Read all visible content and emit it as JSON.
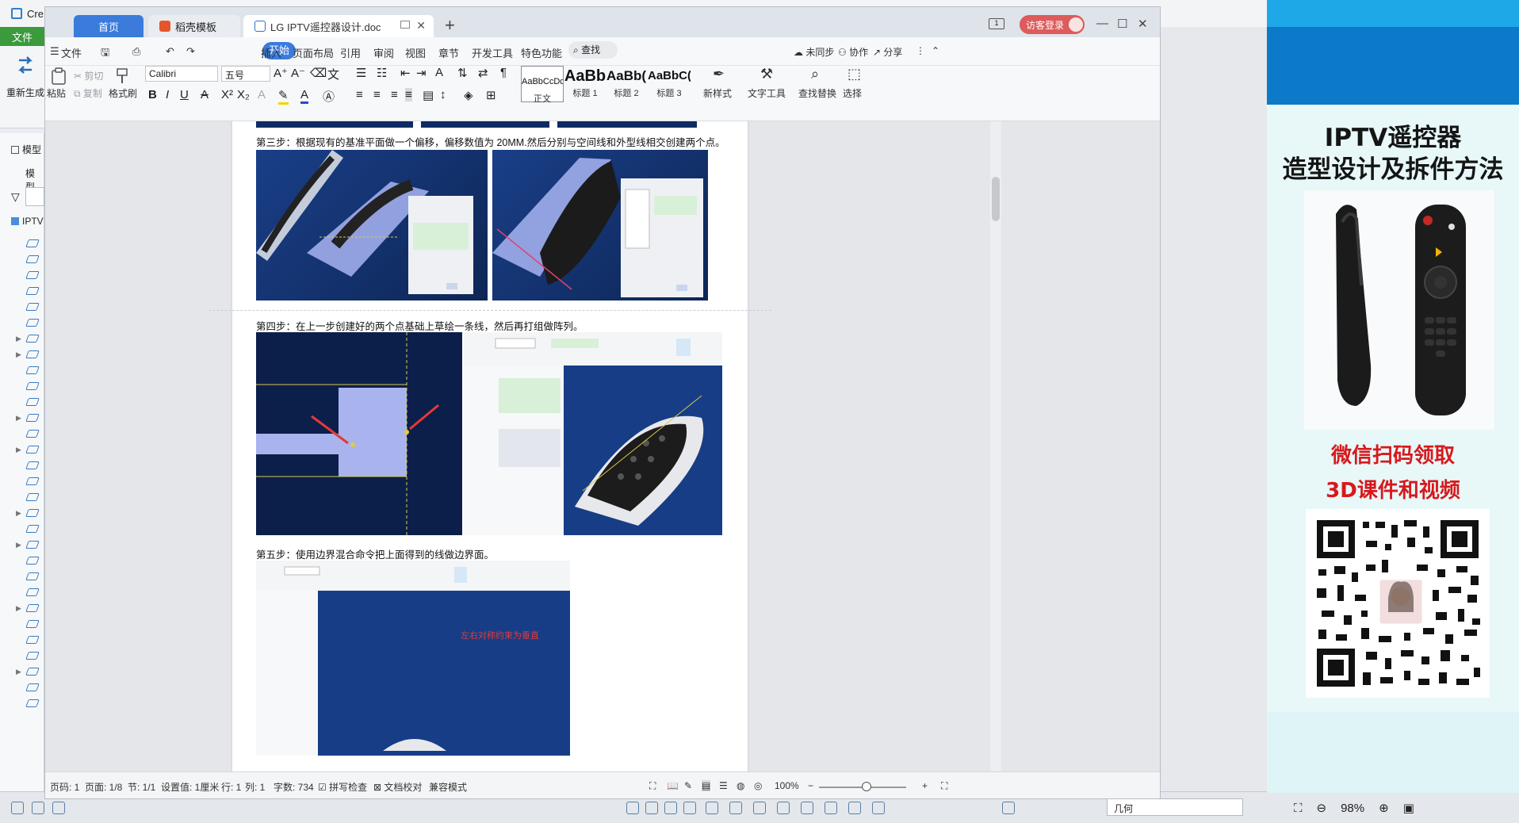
{
  "cad": {
    "title": "Cre",
    "file_tab": "文件",
    "regen": "重新生成",
    "tree_head": "模型",
    "tree_sub": "模型",
    "tree_root": "IPTV",
    "geometry_filter": "几何",
    "zoom": "98%"
  },
  "wps": {
    "tabs": {
      "home": "首页",
      "template": "稻壳模板",
      "doc": "LG IPTV遥控器设计.doc"
    },
    "login": "访客登录",
    "layout_badge": "1",
    "menu": [
      "文件",
      "开始",
      "插入",
      "页面布局",
      "引用",
      "审阅",
      "视图",
      "章节",
      "开发工具",
      "特色功能"
    ],
    "search": "查找",
    "menu_right": {
      "sync": "未同步",
      "collab": "协作",
      "share": "分享"
    },
    "ribbon": {
      "paste": "粘贴",
      "cut": "剪切",
      "copy": "复制",
      "format_painter": "格式刷",
      "font_name": "Calibri",
      "font_size": "五号",
      "styles": [
        {
          "sample": "AaBbCcDd",
          "name": "正文"
        },
        {
          "sample": "AaBb",
          "name": "标题 1"
        },
        {
          "sample": "AaBb(",
          "name": "标题 2"
        },
        {
          "sample": "AaBbC(",
          "name": "标题 3"
        }
      ],
      "new_style": "新样式",
      "text_tools": "文字工具",
      "find_replace": "查找替换",
      "select": "选择"
    }
  },
  "document": {
    "step3": "第三步：根据现有的基准平面做一个偏移，偏移数值为 20MM.然后分别与空间线和外型线相交创建两个点。",
    "step4": "第四步：在上一步创建好的两个点基础上草绘一条线，然后再打组做阵列。",
    "step5": "第五步：使用边界混合命令把上面得到的线做边界面。",
    "annotation": "左右对称约束为垂直"
  },
  "status": {
    "page_code": "页码: 1",
    "page": "页面: 1/8",
    "section": "节: 1/1",
    "setting": "设置值: 1厘米",
    "row": "行: 1",
    "col": "列: 1",
    "words": "字数: 734",
    "spell": "拼写检查",
    "proof": "文档校对",
    "compat": "兼容模式",
    "zoom": "100%"
  },
  "promo": {
    "title1": "IPTV遥控器",
    "title2": "造型设计及拆件方法",
    "wechat1": "微信扫码领取",
    "wechat2": "3D课件和视频"
  },
  "colors": {
    "accent": "#3a7bdc",
    "promo_red": "#d7191c",
    "cad_blue": "#0f2b63"
  }
}
